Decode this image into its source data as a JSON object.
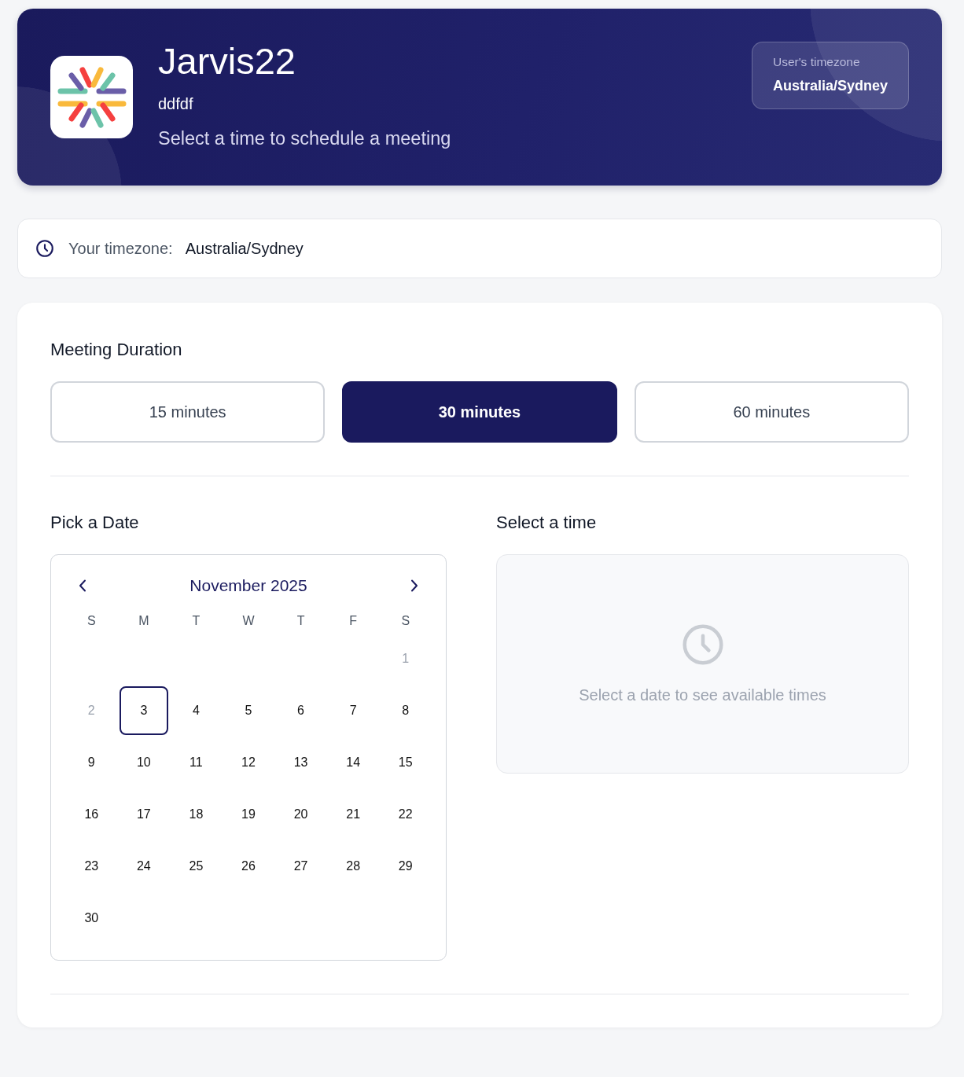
{
  "header": {
    "title": "Jarvis22",
    "subtitle": "ddfdf",
    "tagline": "Select a time to schedule a meeting",
    "timezone_badge": {
      "label": "User's timezone",
      "value": "Australia/Sydney"
    }
  },
  "timezone_bar": {
    "label": "Your timezone:",
    "value": "Australia/Sydney"
  },
  "duration": {
    "heading": "Meeting Duration",
    "options": [
      {
        "label": "15 minutes",
        "selected": false
      },
      {
        "label": "30 minutes",
        "selected": true
      },
      {
        "label": "60 minutes",
        "selected": false
      }
    ]
  },
  "date_picker": {
    "heading": "Pick a Date",
    "month": "November 2025",
    "weekdays": [
      "S",
      "M",
      "T",
      "W",
      "T",
      "F",
      "S"
    ],
    "weeks": [
      [
        {
          "label": "1",
          "disabled": true,
          "selected": false
        }
      ],
      [
        {
          "label": "2",
          "disabled": true,
          "selected": false
        },
        {
          "label": "3",
          "disabled": false,
          "selected": true
        },
        {
          "label": "4",
          "disabled": false,
          "selected": false
        },
        {
          "label": "5",
          "disabled": false,
          "selected": false
        },
        {
          "label": "6",
          "disabled": false,
          "selected": false
        },
        {
          "label": "7",
          "disabled": false,
          "selected": false
        },
        {
          "label": "8",
          "disabled": false,
          "selected": false
        }
      ],
      [
        {
          "label": "9",
          "disabled": false,
          "selected": false
        },
        {
          "label": "10",
          "disabled": false,
          "selected": false
        },
        {
          "label": "11",
          "disabled": false,
          "selected": false
        },
        {
          "label": "12",
          "disabled": false,
          "selected": false
        },
        {
          "label": "13",
          "disabled": false,
          "selected": false
        },
        {
          "label": "14",
          "disabled": false,
          "selected": false
        },
        {
          "label": "15",
          "disabled": false,
          "selected": false
        }
      ],
      [
        {
          "label": "16",
          "disabled": false,
          "selected": false
        },
        {
          "label": "17",
          "disabled": false,
          "selected": false
        },
        {
          "label": "18",
          "disabled": false,
          "selected": false
        },
        {
          "label": "19",
          "disabled": false,
          "selected": false
        },
        {
          "label": "20",
          "disabled": false,
          "selected": false
        },
        {
          "label": "21",
          "disabled": false,
          "selected": false
        },
        {
          "label": "22",
          "disabled": false,
          "selected": false
        }
      ],
      [
        {
          "label": "23",
          "disabled": false,
          "selected": false
        },
        {
          "label": "24",
          "disabled": false,
          "selected": false
        },
        {
          "label": "25",
          "disabled": false,
          "selected": false
        },
        {
          "label": "26",
          "disabled": false,
          "selected": false
        },
        {
          "label": "27",
          "disabled": false,
          "selected": false
        },
        {
          "label": "28",
          "disabled": false,
          "selected": false
        },
        {
          "label": "29",
          "disabled": false,
          "selected": false
        }
      ],
      [
        {
          "label": "30",
          "disabled": false,
          "selected": false
        }
      ]
    ]
  },
  "time_picker": {
    "heading": "Select a time",
    "empty_message": "Select a date to see available times"
  }
}
